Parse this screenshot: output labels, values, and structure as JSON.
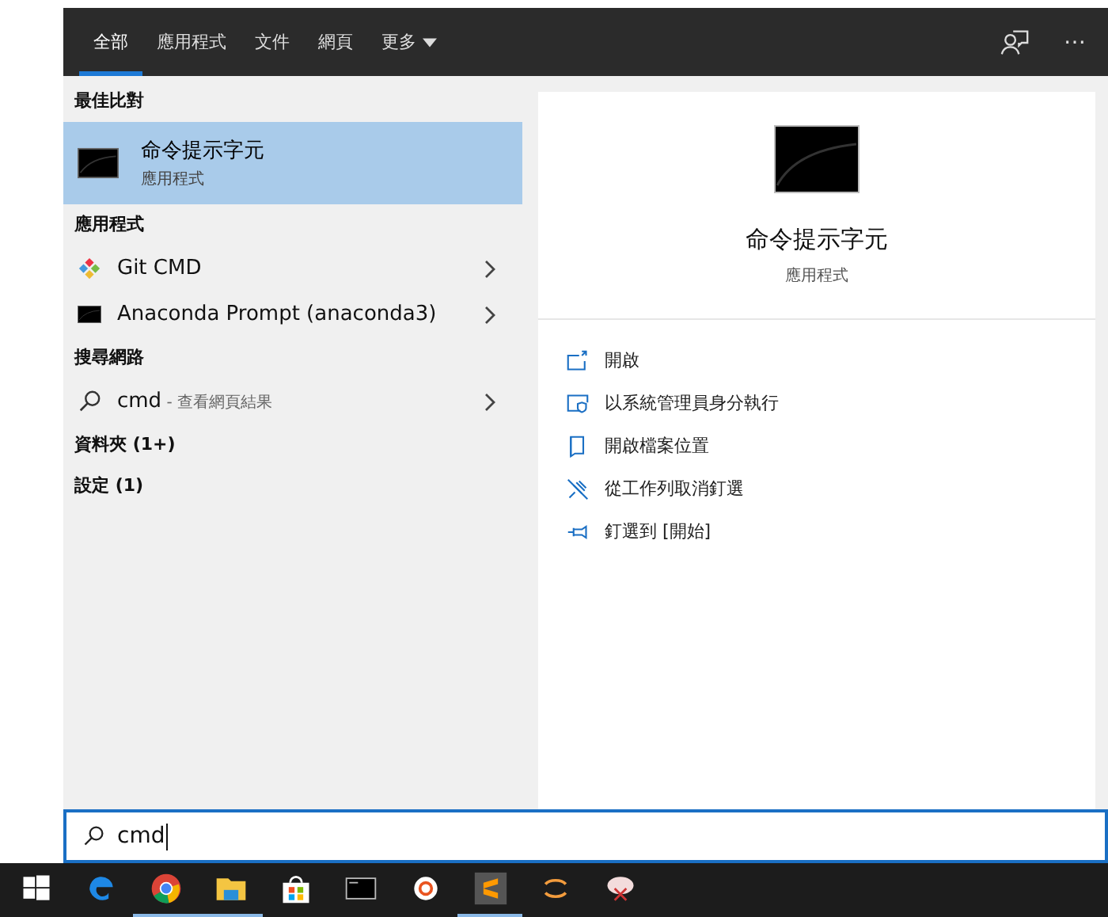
{
  "tabs": [
    {
      "label": "全部",
      "selected": true
    },
    {
      "label": "應用程式",
      "selected": false
    },
    {
      "label": "文件",
      "selected": false
    },
    {
      "label": "網頁",
      "selected": false
    },
    {
      "label": "更多",
      "selected": false,
      "dropdown": true
    }
  ],
  "header_actions": [
    "⋯"
  ],
  "sections": [
    {
      "title": "最佳比對",
      "items": [
        {
          "kind": "best",
          "name": "命令提示字元",
          "subtitle": "應用程式",
          "selected": true
        }
      ]
    },
    {
      "title": "應用程式",
      "items": [
        {
          "kind": "app",
          "name": "Git CMD",
          "selected": false
        },
        {
          "kind": "app",
          "name": "Anaconda Prompt (anaconda3)",
          "selected": false
        }
      ]
    },
    {
      "title": "搜尋網路",
      "items": [
        {
          "kind": "web",
          "name": "cmd",
          "hint": " - 查看網頁結果",
          "selected": false
        }
      ]
    },
    {
      "title": "資料夾 (1+)"
    },
    {
      "title": "設定 (1)"
    }
  ],
  "preview": {
    "name": "命令提示字元",
    "subtitle": "應用程式"
  },
  "actions": [
    "開啟",
    "以系統管理員身分執行",
    "開啟檔案位置",
    "從工作列取消釘選",
    "釘選到 [開始]"
  ],
  "search": {
    "value": "cmd"
  },
  "taskbar": [
    {
      "kind": "start",
      "running": false
    },
    {
      "kind": "edge",
      "running": false
    },
    {
      "kind": "chrome",
      "running": true
    },
    {
      "kind": "explorer",
      "running": true
    },
    {
      "kind": "store",
      "running": false
    },
    {
      "kind": "terminal",
      "running": false
    },
    {
      "kind": "ubuntu",
      "running": false
    },
    {
      "kind": "sublime",
      "running": true
    },
    {
      "kind": "anaconda",
      "running": false
    },
    {
      "kind": "snip",
      "running": false
    }
  ]
}
